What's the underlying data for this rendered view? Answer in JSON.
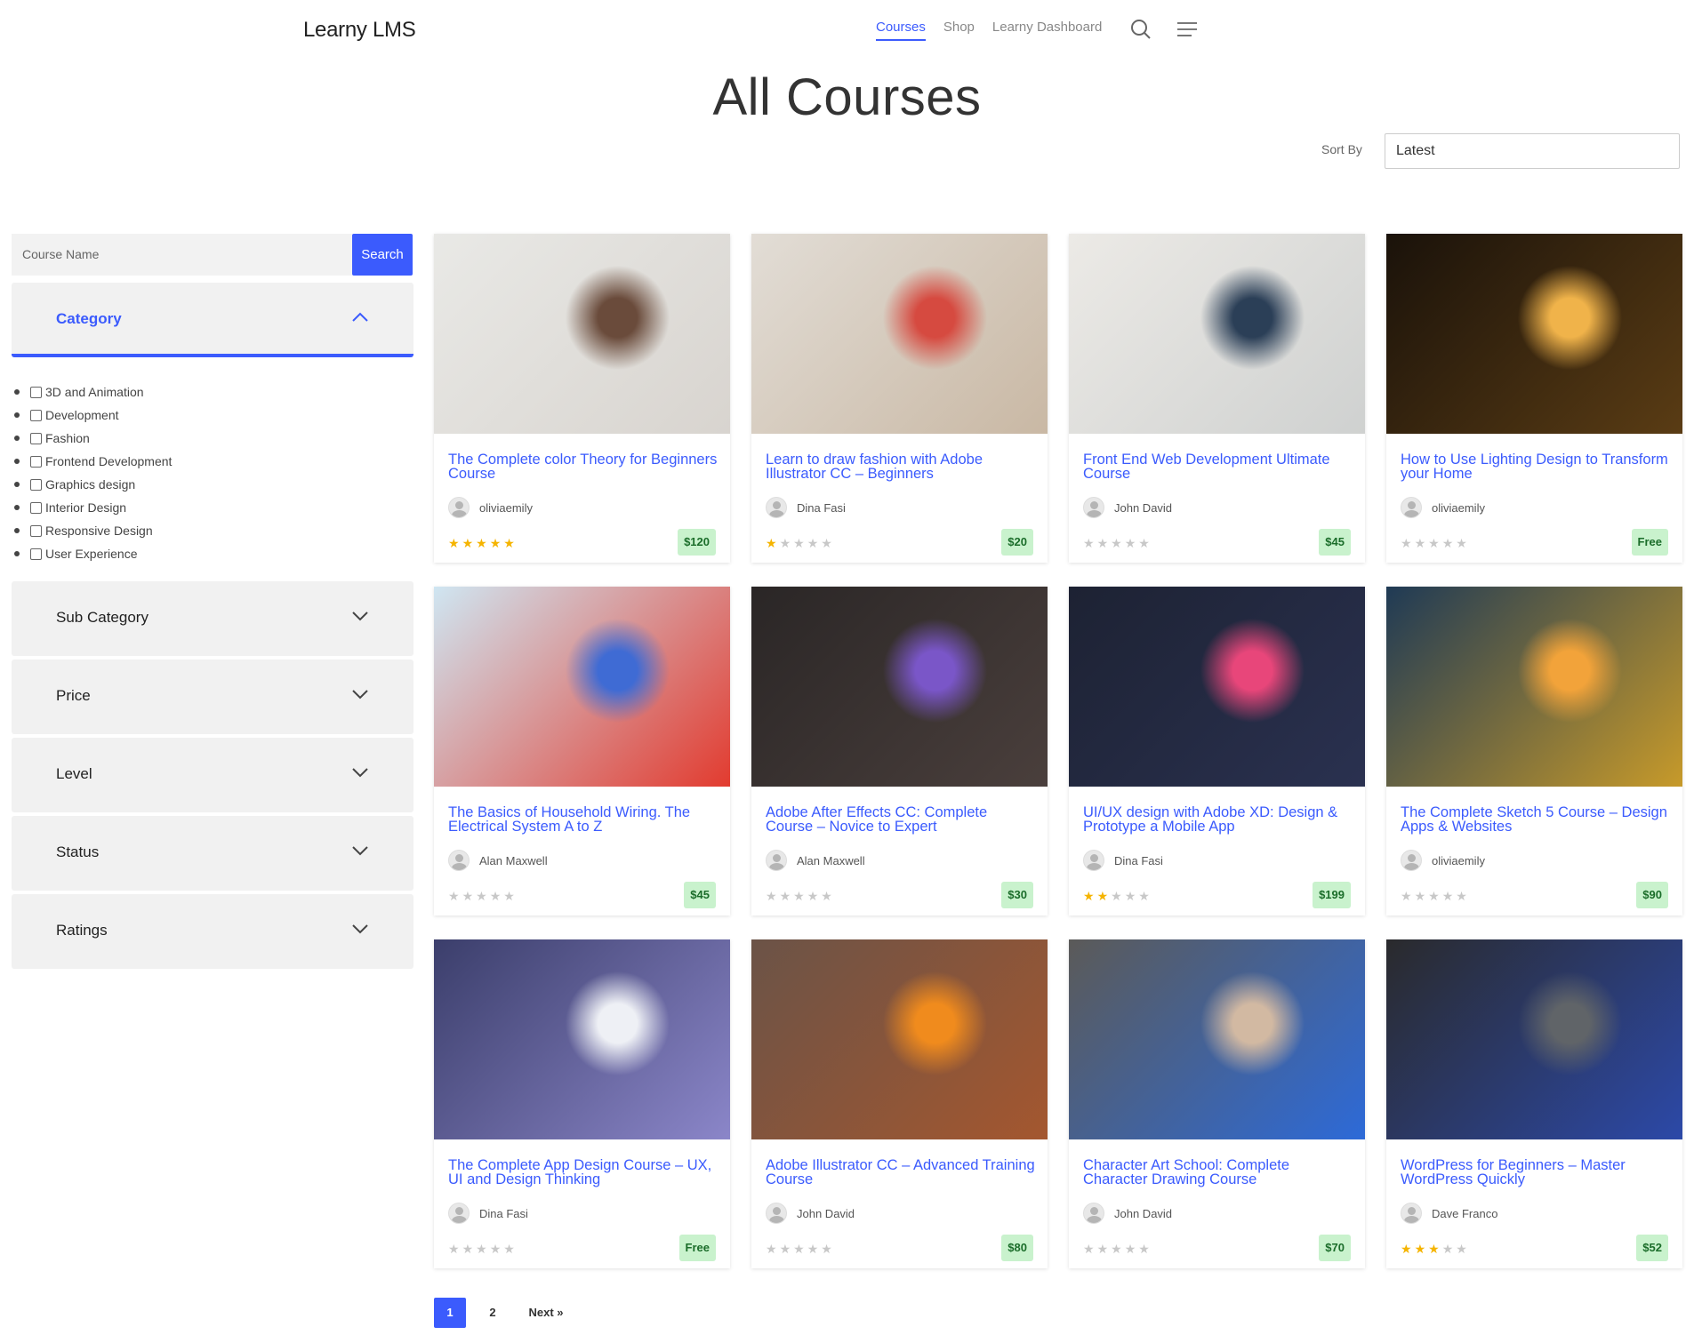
{
  "header": {
    "logo": "Learny LMS",
    "nav": [
      "Courses",
      "Shop",
      "Learny Dashboard"
    ],
    "active_nav": "Courses",
    "icons": [
      "search-icon",
      "menu-icon"
    ]
  },
  "page_title": "All Courses",
  "sort": {
    "label": "Sort By",
    "value": "Latest"
  },
  "search": {
    "placeholder": "Course Name",
    "button": "Search"
  },
  "filters": {
    "category": {
      "label": "Category",
      "items": [
        "3D and Animation",
        "Development",
        "Fashion",
        "Frontend Development",
        "Graphics design",
        "Interior Design",
        "Responsive Design",
        "User Experience"
      ]
    },
    "sub_category": "Sub Category",
    "price": "Price",
    "level": "Level",
    "status": "Status",
    "ratings": "Ratings"
  },
  "courses": [
    {
      "title": "The Complete color Theory for Beginners Course",
      "author": "oliviaemily",
      "rating": 5,
      "price": "$120",
      "thumb_colors": [
        "#e9e9e6",
        "#d8d4cf",
        "#6a4b3b"
      ]
    },
    {
      "title": "Learn to draw fashion with Adobe Illustrator CC – Beginners",
      "author": "Dina Fasi",
      "rating": 1,
      "price": "$20",
      "thumb_colors": [
        "#e2ddd6",
        "#c9b8a4",
        "#d64a40"
      ]
    },
    {
      "title": "Front End Web Development Ultimate Course",
      "author": "John David",
      "rating": 0,
      "price": "$45",
      "thumb_colors": [
        "#eceae6",
        "#cfd1d0",
        "#2b3f57"
      ]
    },
    {
      "title": "How to Use Lighting Design to Transform your Home",
      "author": "oliviaemily",
      "rating": 0,
      "price": "Free",
      "thumb_colors": [
        "#1a120a",
        "#5a3c14",
        "#f0b34a"
      ]
    },
    {
      "title": "The Basics of Household Wiring. The Electrical System A to Z",
      "author": "Alan Maxwell",
      "rating": 0,
      "price": "$45",
      "thumb_colors": [
        "#cfe6f2",
        "#e23b2f",
        "#3f6bd4"
      ]
    },
    {
      "title": "Adobe After Effects CC: Complete Course – Novice to Expert",
      "author": "Alan Maxwell",
      "rating": 0,
      "price": "$30",
      "thumb_colors": [
        "#2a2626",
        "#4a3f3c",
        "#7a56c8"
      ]
    },
    {
      "title": "UI/UX design with Adobe XD: Design & Prototype a Mobile App",
      "author": "Dina Fasi",
      "rating": 2,
      "price": "$199",
      "thumb_colors": [
        "#1d2233",
        "#2a3150",
        "#e8467a"
      ]
    },
    {
      "title": "The Complete Sketch 5 Course – Design Apps & Websites",
      "author": "oliviaemily",
      "rating": 0,
      "price": "$90",
      "thumb_colors": [
        "#1f3a55",
        "#c79a2a",
        "#f2a33a"
      ]
    },
    {
      "title": "The Complete App Design Course – UX, UI and Design Thinking",
      "author": "Dina Fasi",
      "rating": 0,
      "price": "Free",
      "thumb_colors": [
        "#3b3e6b",
        "#8b86c9",
        "#eef0f5"
      ]
    },
    {
      "title": "Adobe Illustrator CC – Advanced Training Course",
      "author": "John David",
      "rating": 0,
      "price": "$80",
      "thumb_colors": [
        "#6b5347",
        "#a4572f",
        "#f08b1d"
      ]
    },
    {
      "title": "Character Art School: Complete Character Drawing Course",
      "author": "John David",
      "rating": 0,
      "price": "$70",
      "thumb_colors": [
        "#5b5a58",
        "#2d6ad8",
        "#d2b9a2"
      ]
    },
    {
      "title": "WordPress for Beginners – Master WordPress Quickly",
      "author": "Dave Franco",
      "rating": 3,
      "price": "$52",
      "thumb_colors": [
        "#2a2a2c",
        "#2c49a8",
        "#606468"
      ]
    }
  ],
  "pagination": {
    "pages": [
      "1",
      "2"
    ],
    "current": "1",
    "next": "Next »"
  }
}
